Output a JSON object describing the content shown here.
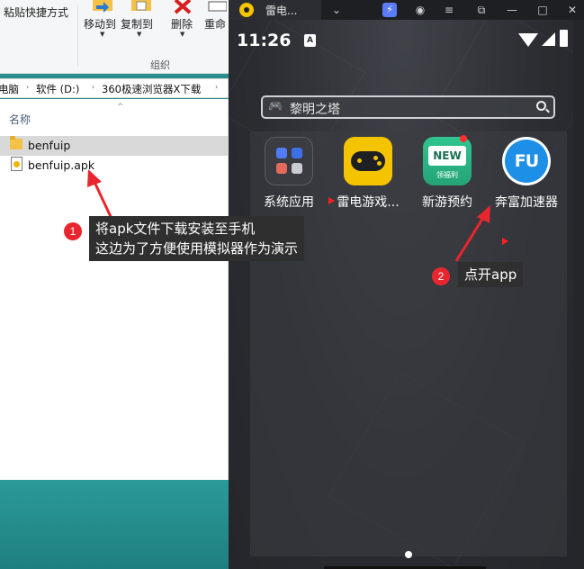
{
  "explorer": {
    "ribbon": {
      "paste_shortcut": "粘贴快捷方式",
      "move_to": "移动到",
      "copy_to": "复制到",
      "delete": "删除",
      "rename": "重命",
      "group_label": "组织"
    },
    "address": {
      "parts": [
        "电脑",
        "软件 (D:)",
        "360极速浏览器X下载"
      ]
    },
    "column_header": "名称",
    "files": [
      {
        "name": "benfuip",
        "type": "folder"
      },
      {
        "name": "benfuip.apk",
        "type": "apk"
      }
    ]
  },
  "emulator": {
    "tab_title": "雷电...",
    "status": {
      "time": "11:26",
      "badge": "A"
    },
    "search": {
      "text": "黎明之塔"
    },
    "apps": [
      {
        "label": "系统应用",
        "icon": "folder-grid-icon"
      },
      {
        "label": "雷电游戏...",
        "icon": "gamepad-icon"
      },
      {
        "label": "新游预约",
        "icon": "new-game-icon",
        "badge_text": "NEW",
        "sub_text": "领福利"
      },
      {
        "label": "奔富加速器",
        "icon": "fu-accelerator-icon",
        "icon_text": "FU"
      }
    ]
  },
  "annotations": [
    {
      "num": "1",
      "lines": [
        "将apk文件下载安装至手机",
        "这边为了方便使用模拟器作为演示"
      ]
    },
    {
      "num": "2",
      "lines": [
        "点开app"
      ]
    }
  ],
  "colors": {
    "accent_red": "#e8262e",
    "callout_bg": "#2f2f2f",
    "app_yellow": "#f5c400",
    "app_blue": "#1e8fe6"
  }
}
